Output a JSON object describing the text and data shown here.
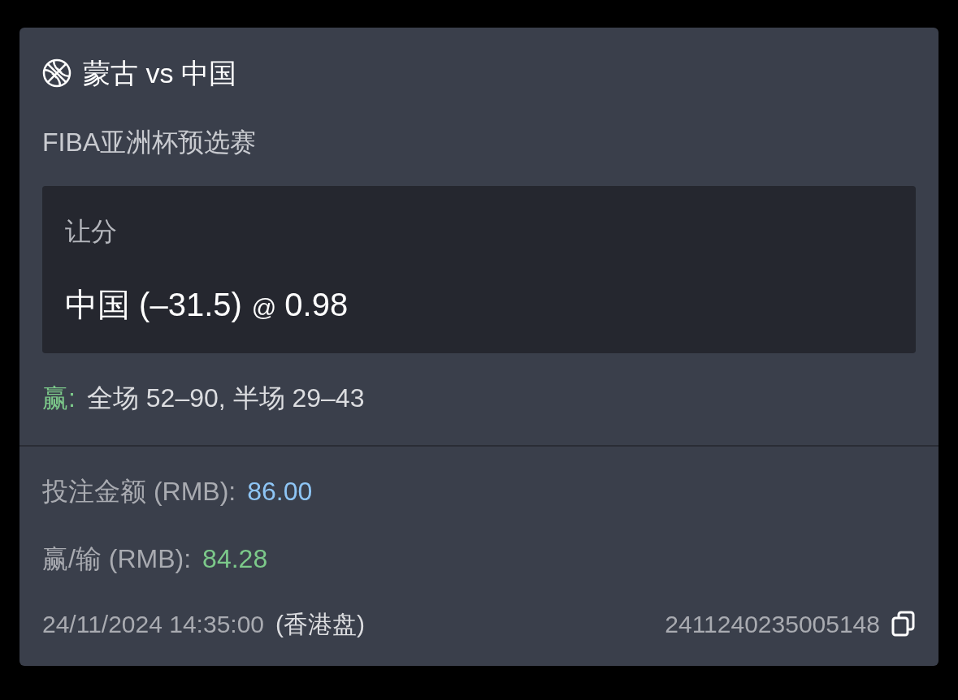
{
  "match": {
    "title": "蒙古 vs 中国",
    "league": "FIBA亚洲杯预选赛"
  },
  "bet": {
    "market": "让分",
    "selection": "中国 (–31.5)",
    "at": "@",
    "odds": "0.98"
  },
  "result": {
    "label": "赢:",
    "text": "全场 52–90, 半场 29–43"
  },
  "stake": {
    "label": "投注金额 (RMB):",
    "value": "86.00"
  },
  "win_loss": {
    "label": "赢/输 (RMB):",
    "value": "84.28"
  },
  "footer": {
    "time": "24/11/2024 14:35:00",
    "market_type": "(香港盘)",
    "bet_id": "2411240235005148"
  }
}
